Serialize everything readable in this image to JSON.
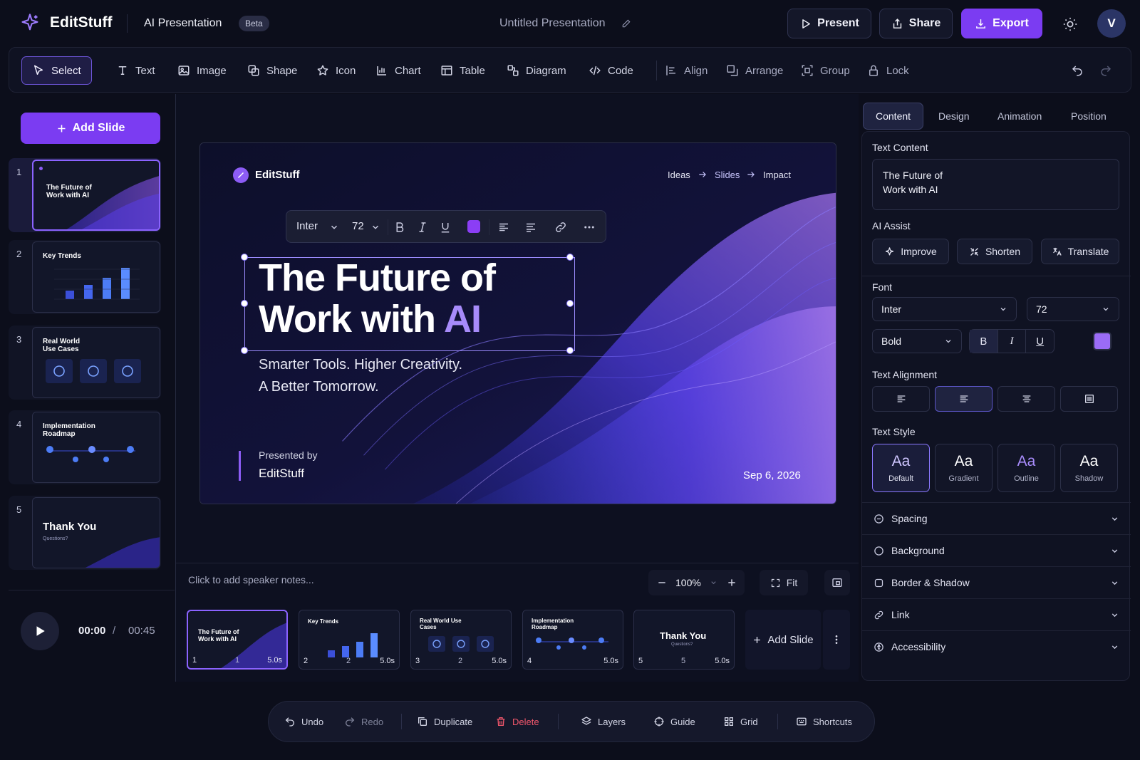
{
  "header": {
    "brand": "EditStuff",
    "mode": "AI Presentation",
    "badge": "Beta",
    "doc_title": "Untitled Presentation",
    "present": "Present",
    "share": "Share",
    "export": "Export",
    "avatar": "V"
  },
  "toolbar": {
    "tools": [
      "Select",
      "Text",
      "Image",
      "Shape",
      "Icon",
      "Chart",
      "Table",
      "Diagram",
      "Code"
    ],
    "arrange": [
      "Align",
      "Arrange",
      "Group",
      "Lock"
    ]
  },
  "left": {
    "add_slide": "Add Slide",
    "slides": [
      {
        "num": "1",
        "title": "The Future of Work with AI"
      },
      {
        "num": "2",
        "title": "Key Trends"
      },
      {
        "num": "3",
        "title": "Real World Use Cases"
      },
      {
        "num": "4",
        "title": "Implementation Roadmap"
      },
      {
        "num": "5",
        "title": "Thank You",
        "sub": "Questions?"
      }
    ],
    "time_current": "00:00",
    "time_sep": "/",
    "time_total": "00:45"
  },
  "slide": {
    "brand": "EditStuff",
    "crumbs": [
      "Ideas",
      "Slides",
      "Impact"
    ],
    "title_line1": "The Future of",
    "title_line2": "Work with ",
    "title_accent": "AI",
    "subtitle_line1": "Smarter Tools. Higher Creativity.",
    "subtitle_line2": "A Better Tomorrow.",
    "presented_by": "Presented by",
    "presenter": "EditStuff",
    "date": "Sep 6, 2026"
  },
  "format_bar": {
    "font": "Inter",
    "size": "72",
    "color": "#8b3ef5"
  },
  "notes": {
    "placeholder": "Click to add speaker notes...",
    "zoom": "100%",
    "fit": "Fit"
  },
  "filmstrip": {
    "items": [
      {
        "idx": "1",
        "mid": "1",
        "dur": "5.0s"
      },
      {
        "idx": "2",
        "mid": "2",
        "dur": "5.0s"
      },
      {
        "idx": "3",
        "mid": "2",
        "dur": "5.0s"
      },
      {
        "idx": "4",
        "mid": "",
        "dur": "5.0s"
      },
      {
        "idx": "5",
        "mid": "5",
        "dur": "5.0s"
      }
    ],
    "add": "Add Slide"
  },
  "right": {
    "tabs": [
      "Content",
      "Design",
      "Animation",
      "Position"
    ],
    "text_content_label": "Text Content",
    "text_content": "The Future of\nWork with AI",
    "ai_assist_label": "AI Assist",
    "ai": [
      "Improve",
      "Shorten",
      "Translate"
    ],
    "font_label": "Font",
    "font": "Inter",
    "size": "72",
    "weight": "Bold",
    "color": "#9b6cf7",
    "alignment_label": "Text Alignment",
    "style_label": "Text Style",
    "styles": [
      {
        "aa": "Aa",
        "name": "Default"
      },
      {
        "aa": "Aa",
        "name": "Gradient"
      },
      {
        "aa": "Aa",
        "name": "Outline"
      },
      {
        "aa": "Aa",
        "name": "Shadow"
      }
    ],
    "sections": [
      "Spacing",
      "Background",
      "Border & Shadow",
      "Link",
      "Accessibility"
    ]
  },
  "bottom": {
    "undo": "Undo",
    "redo": "Redo",
    "duplicate": "Duplicate",
    "delete": "Delete",
    "layers": "Layers",
    "guide": "Guide",
    "grid": "Grid",
    "shortcuts": "Shortcuts"
  },
  "colors": {
    "accent": "#7b3cf2",
    "background": "#0c0e1b",
    "danger": "#f0566b"
  }
}
